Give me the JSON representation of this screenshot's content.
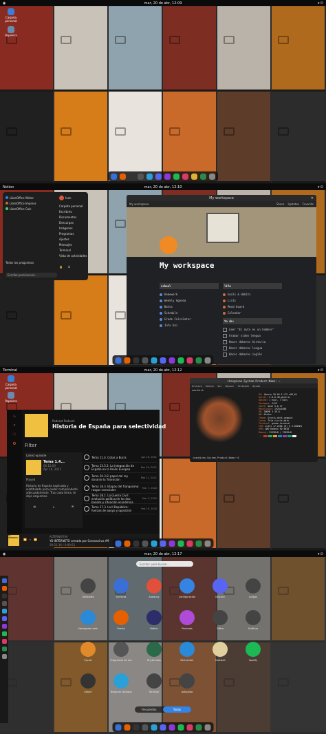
{
  "panel1": {
    "clock": "mar, 20 de abr, 12:09",
    "desktop_icons": [
      "Carpeta personal",
      "Papelera"
    ]
  },
  "panel2": {
    "activities": "Notion",
    "clock": "mar, 20 de abr, 12:10",
    "menu_left": [
      "LibreOffice Writer",
      "LibreOffice Impress",
      "LibreOffice Calc"
    ],
    "menu_all": "Todos los programas",
    "menu_search": "Escriba para buscar...",
    "menu_user": "Ivan",
    "menu_right": [
      "Carpeta personal",
      "Escritorio",
      "Documentos",
      "Descargas",
      "Imágenes",
      "Programas",
      "Ajustes",
      "Mensajes",
      "Terminal",
      "Vista de actividades"
    ],
    "notion": {
      "title": "My workspace",
      "crumb": "My workspace",
      "share": "Share",
      "updates": "Updates",
      "favorite": "Favorite",
      "heading": "My workspace",
      "school_header": "school",
      "school_items": [
        "Homework",
        "Weekly Agenda",
        "Notes",
        "Schedule",
        "Grade Calculator",
        "Info Uni"
      ],
      "life_header": "life",
      "life_items": [
        "Goals & Habits",
        "Lists",
        "Mood board",
        "Calendar"
      ],
      "todo_header": "to do:",
      "todo_items": [
        "Leer \"El auto es un hombre\"",
        "Grabar video lengua",
        "Hacer deberes historia",
        "Hacer deberes lengua",
        "Hacer deberes inglés"
      ]
    }
  },
  "panel3": {
    "activities": "Terminal",
    "clock": "mar, 20 de abr, 12:12",
    "desktop_icons": [
      "Carpeta personal",
      "Papelera"
    ],
    "podcast": {
      "label": "Podcast Podcast",
      "title": "Historia de España para selectividad",
      "filter": "Filter",
      "latest": "Latest episode",
      "latest_ep": "Tema 1.4...",
      "latest_meta": "00:16:09",
      "latest_date": "Apr 16, 2021",
      "played": "Played",
      "desc": "Historia de España explicada y subtitulada para poder comprenderla adecuadamente. Tras cada tema, te dejo esquemas.",
      "episodes": [
        {
          "title": "Tema 11.4. Cotas a Burra",
          "dur": "00:14:09",
          "date": "Apr 16, 2021"
        },
        {
          "title": "Tema 13.5.3. La integración de España en la Unión Europea",
          "dur": "00:13:34",
          "date": "Mar 29, 2021"
        },
        {
          "title": "Tema 20.3.El papel del rey durante la Transición",
          "dur": "00:16:27",
          "date": "Mar 12, 2021"
        },
        {
          "title": "Tema 18.3. Etapas del franquismo: rasgos esenciales",
          "dur": "00:31:58",
          "date": "Mar 7, 2020"
        },
        {
          "title": "Tema 18.1. La Guerra Civil: evolución política de los dos bandos y situación económica",
          "dur": "00:31:49",
          "date": "Mar 2, 2020"
        },
        {
          "title": "Tema 17.3. La II República: fuerzas de apoyo y oposición",
          "dur": "00:18:07",
          "date": "Feb 19, 2020"
        }
      ],
      "now_show": "ALTERNATIVA",
      "now_title": "YO INTERNETO cerrado por Coronavirus #9",
      "now_time": "00:21:16 / 0:00:51",
      "cover_text": "YO INTERNETO"
    },
    "terminal": {
      "title": "ihas@ivan-System-Product-Name: ~",
      "menu": [
        "Archivo",
        "Editar",
        "Ver",
        "Buscar",
        "Terminal",
        "Ayuda"
      ],
      "command": "neofetch",
      "info": [
        [
          "OS",
          "Ubuntu 20.04.2 LTS x86_64"
        ],
        [
          "Kernel",
          "5.8.0-48-generic"
        ],
        [
          "Uptime",
          "1 hour, 7 mins"
        ],
        [
          "Packages",
          "2419"
        ],
        [
          "Shell",
          "bash 5.0.17"
        ],
        [
          "Resolution",
          "1920x1080"
        ],
        [
          "DE",
          "GNOME 3.36.8"
        ],
        [
          "WM",
          "Mutter"
        ],
        [
          "Theme",
          "Orchis-dark-compact"
        ],
        [
          "Icons",
          "Tela-circle-dark"
        ],
        [
          "Terminal",
          "gnome-terminal"
        ],
        [
          "CPU",
          "Intel i7-2600 (8) @ 3.800GHz"
        ],
        [
          "GPU",
          "AMD Radeon HD 6850"
        ],
        [
          "Memory",
          "2535MiB / 7969MiB"
        ]
      ],
      "prompt": "ivan@ivan-System-Product-Name:~$"
    }
  },
  "panel4": {
    "clock": "mar, 20 de abr, 12:17",
    "search_placeholder": "Escribir para buscar...",
    "apps": [
      "Utilidades",
      "Archivos",
      "Audacity",
      "Configuración",
      "Discord",
      "Juegos",
      "Navegador web",
      "Firefox",
      "Notion",
      "Podcasts",
      "Office",
      "Gráficos",
      "Pycasi",
      "Programas de red",
      "Rhythmbox",
      "Retroceder",
      "Shotwell",
      "Spotify",
      "Steam",
      "Telegram Desktop",
      "Terminal",
      "Activador"
    ],
    "tab_frequent": "Frecuentes",
    "tab_all": "Todas"
  },
  "colors": {
    "accent": "#3584e4",
    "notion_bg": "#202124",
    "orange": "#f08a24"
  }
}
